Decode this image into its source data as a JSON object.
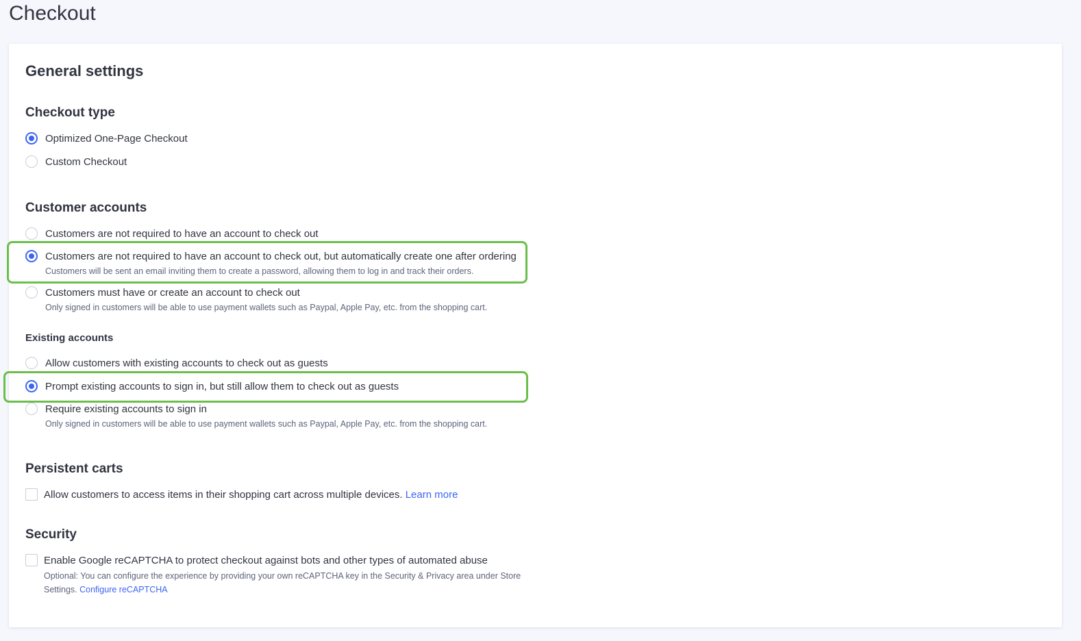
{
  "page": {
    "title": "Checkout"
  },
  "card": {
    "title": "General settings"
  },
  "checkout_type": {
    "heading": "Checkout type",
    "options": [
      {
        "label": "Optimized One-Page Checkout",
        "checked": true
      },
      {
        "label": "Custom Checkout",
        "checked": false
      }
    ]
  },
  "customer_accounts": {
    "heading": "Customer accounts",
    "options": [
      {
        "label": "Customers are not required to have an account to check out",
        "checked": false
      },
      {
        "label": "Customers are not required to have an account to check out, but automatically create one after ordering",
        "description": "Customers will be sent an email inviting them to create a password, allowing them to log in and track their orders.",
        "checked": true
      },
      {
        "label": "Customers must have or create an account to check out",
        "description": "Only signed in customers will be able to use payment wallets such as Paypal, Apple Pay, etc. from the shopping cart.",
        "checked": false
      }
    ]
  },
  "existing_accounts": {
    "heading": "Existing accounts",
    "options": [
      {
        "label": "Allow customers with existing accounts to check out as guests",
        "checked": false
      },
      {
        "label": "Prompt existing accounts to sign in, but still allow them to check out as guests",
        "checked": true
      },
      {
        "label": "Require existing accounts to sign in",
        "description": "Only signed in customers will be able to use payment wallets such as Paypal, Apple Pay, etc. from the shopping cart.",
        "checked": false
      }
    ]
  },
  "persistent_carts": {
    "heading": "Persistent carts",
    "checkbox_label": "Allow customers to access items in their shopping cart across multiple devices.",
    "link_text": "Learn more",
    "checked": false
  },
  "security": {
    "heading": "Security",
    "checkbox_label": "Enable Google reCAPTCHA to protect checkout against bots and other types of automated abuse",
    "description": "Optional: You can configure the experience by providing your own reCAPTCHA key in the Security & Privacy area under Store Settings.",
    "link_text": "Configure reCAPTCHA",
    "checked": false
  },
  "colors": {
    "accent": "#3c64f4",
    "highlight": "#6abf4b",
    "page_bg": "#f5f7fc",
    "text": "#313440"
  }
}
